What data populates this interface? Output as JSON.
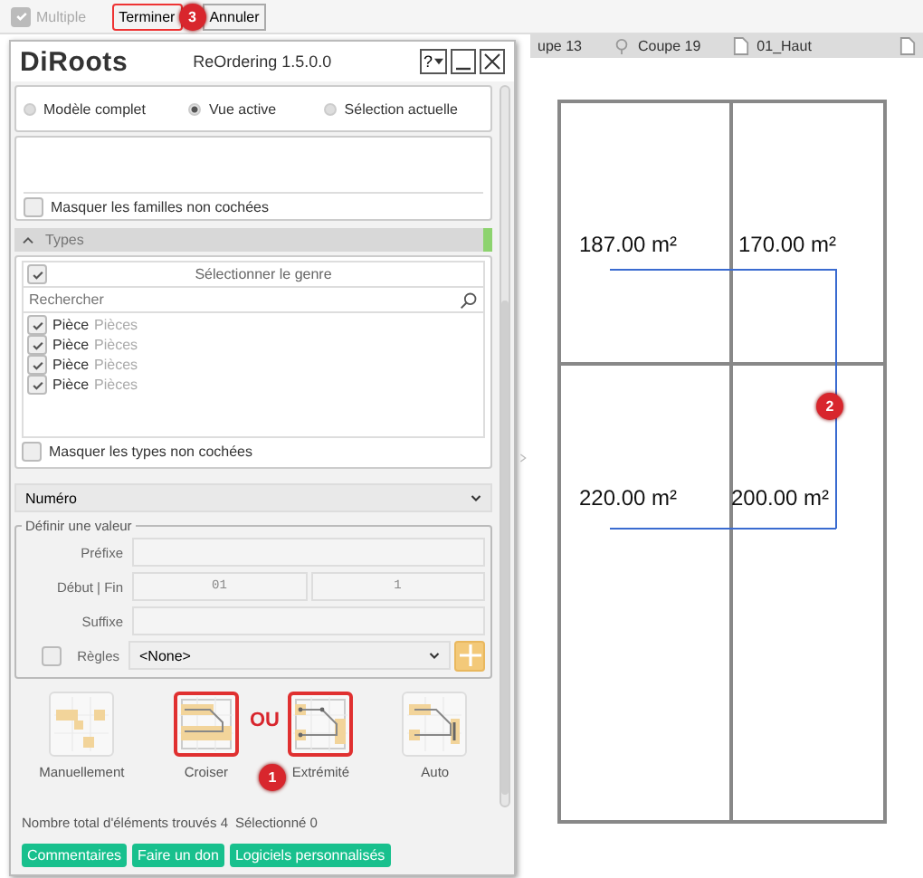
{
  "toolbar": {
    "multiple": {
      "label": "Multiple",
      "checked": true,
      "disabled": true
    },
    "buttons": [
      "Terminer",
      "Annuler"
    ]
  },
  "view_tabs": [
    {
      "label": "upe 13",
      "kind": "none"
    },
    {
      "label": "Coupe 19",
      "kind": "section"
    },
    {
      "label": "01_Haut",
      "kind": "sheet"
    },
    {
      "kind": "sheet"
    }
  ],
  "panel": {
    "brand": "DiRoots",
    "title": "ReOrdering 1.5.0.0",
    "help": "?",
    "scope": [
      {
        "label": "Modèle complet",
        "selected": false
      },
      {
        "label": "Vue active",
        "selected": true
      },
      {
        "label": "Sélection actuelle",
        "selected": false
      }
    ],
    "families": {
      "hide_label": "Masquer les familles non cochées",
      "hide_checked": false
    },
    "types": {
      "header": "Types",
      "expanded": true,
      "select_all": {
        "label": "Sélectionner le genre",
        "checked": true
      },
      "search_placeholder": "Rechercher",
      "items": [
        {
          "name": "Pièce",
          "category": "Pièces",
          "checked": true
        },
        {
          "name": "Pièce",
          "category": "Pièces",
          "checked": true
        },
        {
          "name": "Pièce",
          "category": "Pièces",
          "checked": true
        },
        {
          "name": "Pièce",
          "category": "Pièces",
          "checked": true
        }
      ],
      "hide_label": "Masquer les types non cochées",
      "hide_checked": false
    },
    "parameter": "Numéro",
    "value_group": {
      "legend": "Définir une valeur",
      "prefix_label": "Préfixe",
      "start_end_label": "Début | Fin",
      "start": "01",
      "end": "1",
      "suffix_label": "Suffixe",
      "rules": {
        "label": "Règles",
        "checked": false,
        "value": "<None>"
      }
    },
    "methods": [
      {
        "label": "Manuellement",
        "kind": "manual",
        "highlighted": false
      },
      {
        "label": "Croiser",
        "kind": "cross",
        "highlighted": true
      },
      {
        "label": "Extrémité",
        "kind": "end",
        "highlighted": true
      },
      {
        "label": "Auto",
        "kind": "auto",
        "highlighted": false
      }
    ],
    "or_label": "OU",
    "status": {
      "found_label": "Nombre total d'éléments trouvés",
      "found": "4",
      "selected_label": "Sélectionné",
      "selected": "0"
    },
    "footer_buttons": [
      "Commentaires",
      "Faire un don",
      "Logiciels personnalisés"
    ]
  },
  "callouts": {
    "methods": "1",
    "plan": "2",
    "toolbar": "3"
  },
  "plan": {
    "rooms": [
      {
        "area": "187.00 m²"
      },
      {
        "area": "170.00 m²"
      },
      {
        "area": "220.00 m²"
      },
      {
        "area": "200.00 m²"
      }
    ]
  }
}
